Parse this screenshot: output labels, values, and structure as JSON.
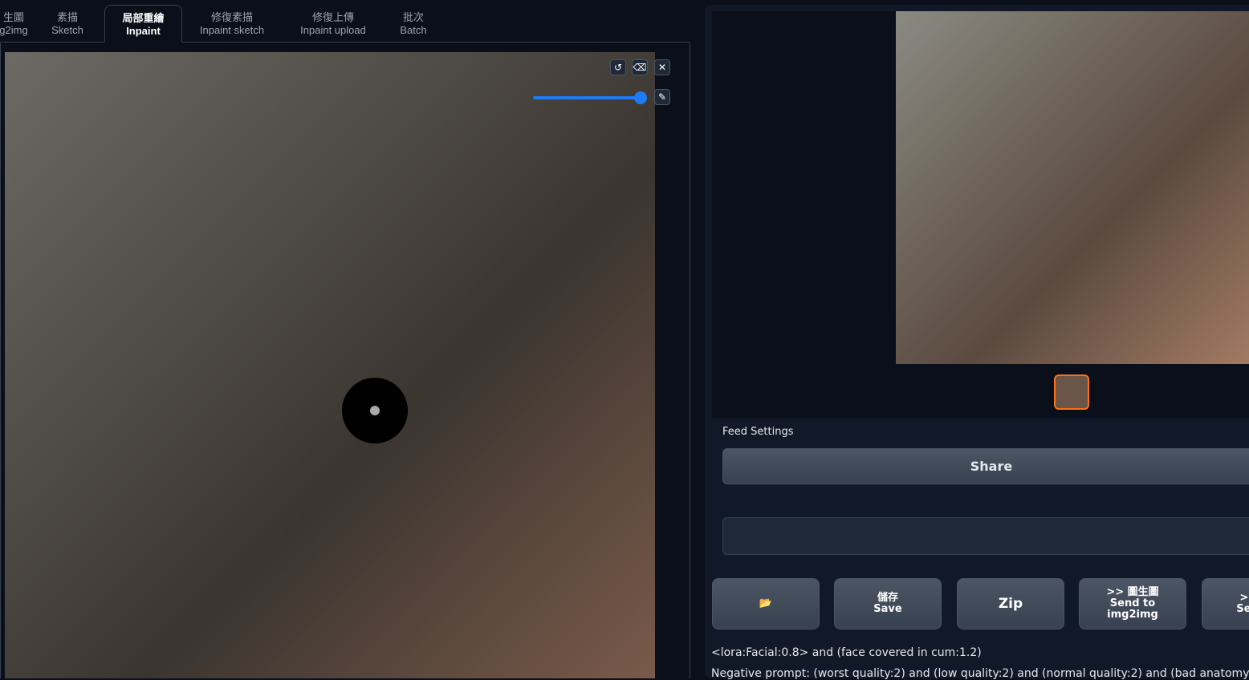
{
  "tabs": [
    {
      "zh": "生圖",
      "en": "g2img"
    },
    {
      "zh": "素描",
      "en": "Sketch"
    },
    {
      "zh": "局部重繪",
      "en": "Inpaint",
      "selected": true
    },
    {
      "zh": "修復素描",
      "en": "Inpaint sketch"
    },
    {
      "zh": "修復上傳",
      "en": "Inpaint upload"
    },
    {
      "zh": "批次",
      "en": "Batch"
    }
  ],
  "canvas": {
    "brush_size_fraction": 0.95,
    "undo": "↺",
    "erase": "⌫",
    "close": "✕",
    "brush": "✎"
  },
  "gallery": {
    "feed_label": "Feed Settings",
    "share": "Share",
    "open_folder": "📂",
    "save_zh": "儲存",
    "save_en": "Save",
    "zip": "Zip",
    "send_img2img_zh": ">> 圖生圖",
    "send_img2img_en1": "Send to",
    "send_img2img_en2": "img2img",
    "send_inpaint_zh": ">> 局",
    "send_inpaint_en": "Send t"
  },
  "info": {
    "prompt": "<lora:Facial:0.8> and (face covered in cum:1.2)",
    "negative": "Negative prompt: (worst quality:2) and (low quality:2) and (normal quality:2) and (bad anatomy) and (s"
  },
  "colors": {
    "accent": "#f97316",
    "slider": "#1d7bf5"
  }
}
